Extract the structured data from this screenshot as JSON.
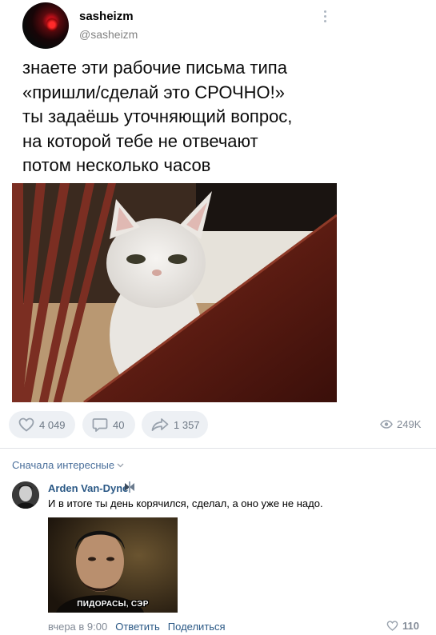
{
  "post": {
    "author_name": "sasheizm",
    "author_handle": "@sasheizm",
    "text_lines": [
      "знаете эти рабочие письма типа",
      "«пришли/сделай это СРОЧНО!»",
      "ты задаёшь уточняющий вопрос,",
      "на которой тебе не отвечают",
      "потом несколько часов"
    ]
  },
  "actions": {
    "likes": "4 049",
    "comments": "40",
    "shares": "1 357",
    "views": "249K"
  },
  "comments_section": {
    "sort_label": "Сначала интересные",
    "comment": {
      "author": "Arden Van-Dyne",
      "text": "И в итоге ты день корячился, сделал, а оно уже не надо.",
      "image_caption": "ПИДОРАСЫ, СЭР",
      "time": "вчера в 9:00",
      "reply_label": "Ответить",
      "share_label": "Поделиться",
      "likes": "110"
    }
  },
  "colors": {
    "link": "#2a5885",
    "muted": "#828a96",
    "pill_bg": "#edf0f4"
  }
}
